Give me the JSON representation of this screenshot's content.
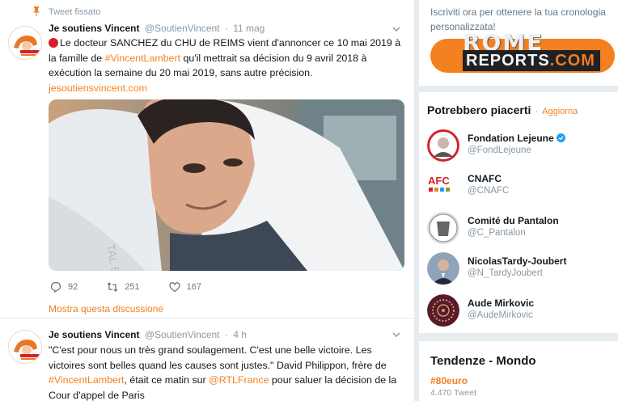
{
  "pinned": {
    "label": "Tweet fissato"
  },
  "tweets": [
    {
      "author": "Je soutiens Vincent",
      "handle": "@SoutienVincent",
      "time": "11 mag",
      "text_1": "Le docteur SANCHEZ du CHU de REIMS vient d'annoncer ce 10 mai 2019 à la famille de ",
      "hashtag": "#VincentLambert",
      "text_2": " qu'il mettrait sa décision du 9 avril 2018 à exécution la semaine du 20 mai 2019, sans autre précision.",
      "link": "jesoutiensvincent.com",
      "replies": "92",
      "retweets": "251",
      "likes": "167",
      "show_thread": "Mostra questa discussione"
    },
    {
      "author": "Je soutiens Vincent",
      "handle": "@SoutienVincent",
      "time": "4 h",
      "text_1": "\"C'est pour nous un très grand soulagement. C'est une belle victoire. Les victoires sont belles quand les causes sont justes.\" David Philippon, frère de ",
      "hashtag": "#VincentLambert",
      "text_2": ", était ce matin sur ",
      "mention": "@RTLFrance",
      "text_3": " pour saluer la décision de la Cour d'appel de Paris"
    }
  ],
  "sidebar": {
    "signup_text": "Iscriviti ora per ottenere la tua cronologia personalizzata!",
    "who_to_follow": {
      "title": "Potrebbero piacerti",
      "separator": " · ",
      "refresh": "Aggiorna",
      "items": [
        {
          "name": "Fondation Lejeune",
          "handle": "@FondLejeune",
          "verified": true
        },
        {
          "name": "CNAFC",
          "handle": "@CNAFC",
          "verified": false
        },
        {
          "name": "Comité du Pantalon",
          "handle": "@C_Pantalon",
          "verified": false
        },
        {
          "name": "NicolasTardy-Joubert",
          "handle": "@N_TardyJoubert",
          "verified": false
        },
        {
          "name": "Aude Mirkovic",
          "handle": "@AudeMirkovic",
          "verified": false
        }
      ]
    },
    "trends": {
      "title": "Tendenze - Mondo",
      "items": [
        {
          "tag": "#80euro",
          "count": "4.470 Tweet"
        }
      ]
    }
  },
  "watermark": {
    "brand_top": "ROME",
    "brand_bottom_1": "REPORTS",
    "brand_bottom_2": ".COM"
  },
  "colors": {
    "accent": "#f4801f",
    "verified": "#1da1f2",
    "text": "#14171a",
    "muted": "#8899a6"
  }
}
